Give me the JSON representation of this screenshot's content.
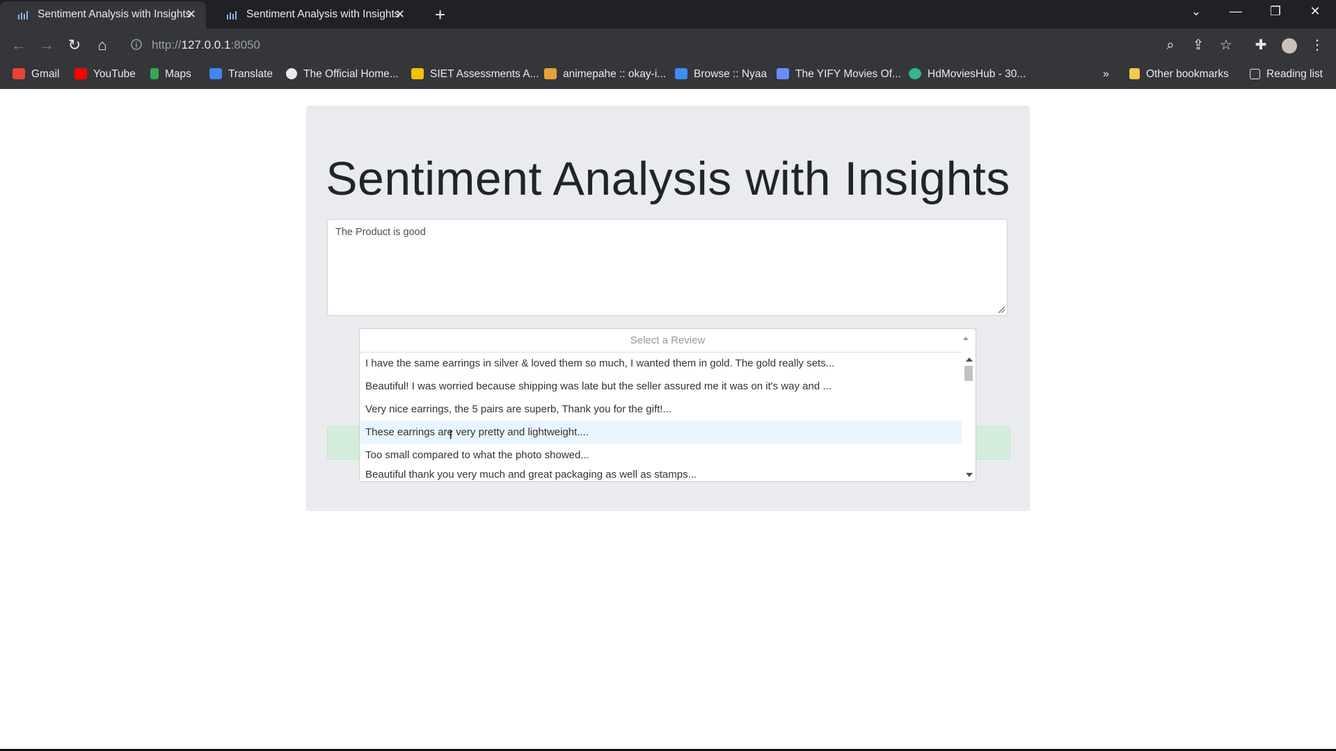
{
  "browser": {
    "tabs": [
      {
        "title": "Sentiment Analysis with Insights",
        "active": true
      },
      {
        "title": "Sentiment Analysis with Insights",
        "active": false
      }
    ],
    "url_host": "127.0.0.1",
    "url_prefix": "http://",
    "url_port": ":8050",
    "bookmarks": [
      {
        "label": "Gmail",
        "icon": "gmail-icon",
        "color": "#ea4335"
      },
      {
        "label": "YouTube",
        "icon": "youtube-icon",
        "color": "#ff0000"
      },
      {
        "label": "Maps",
        "icon": "maps-icon",
        "color": "#34a853"
      },
      {
        "label": "Translate",
        "icon": "translate-icon",
        "color": "#4285f4"
      },
      {
        "label": "The Official Home...",
        "icon": "globe-icon",
        "color": "#e8eaed"
      },
      {
        "label": "SIET Assessments A...",
        "icon": "siet-icon",
        "color": "#f2c200"
      },
      {
        "label": "animepahe :: okay-i...",
        "icon": "animepahe-icon",
        "color": "#e5a33a"
      },
      {
        "label": "Browse :: Nyaa",
        "icon": "nyaa-icon",
        "color": "#3c8df0"
      },
      {
        "label": "The YIFY Movies Of...",
        "icon": "yify-icon",
        "color": "#6b8cff"
      },
      {
        "label": "HdMoviesHub - 30...",
        "icon": "hdmovies-icon",
        "color": "#2fb88a"
      }
    ],
    "overflow": "»",
    "other_bookmarks": "Other bookmarks",
    "reading_list": "Reading list"
  },
  "page": {
    "title": "Sentiment Analysis with Insights",
    "review_text": "The Product is good",
    "dropdown": {
      "placeholder": "Select a Review",
      "options": [
        "I have the same earrings in silver & loved them so much, I wanted them in gold. The gold really sets...",
        "Beautiful! I was worried because shipping was late but the seller assured me it was on it's way and ...",
        "Very nice earrings, the 5 pairs are superb, Thank you for the gift!...",
        "These earrings are very pretty and lightweight....",
        "Too small compared to what the photo showed...",
        "Beautiful thank you very much and great packaging as well as stamps..."
      ],
      "focused_index": 3
    },
    "result_color": "#d4edda"
  }
}
